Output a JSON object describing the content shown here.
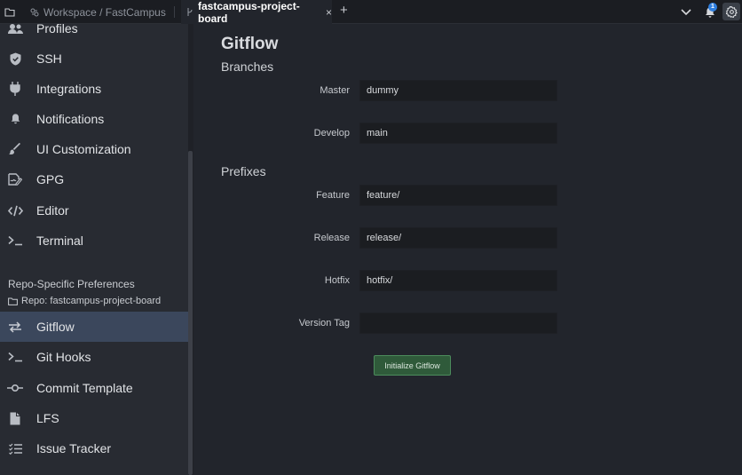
{
  "tabs": {
    "workspace_label": "Workspace / FastCampus",
    "project_label": "fastcampus-project-board",
    "close_glyph": "×",
    "add_glyph": "+"
  },
  "topbar": {
    "notification_count": "1",
    "icons": [
      "folder-icon",
      "chevron-down-icon",
      "bell-icon",
      "gear-icon"
    ]
  },
  "sidebar": {
    "global_items": [
      {
        "label": "Profiles",
        "icon": "users-icon"
      },
      {
        "label": "SSH",
        "icon": "shield-icon"
      },
      {
        "label": "Integrations",
        "icon": "plug-icon"
      },
      {
        "label": "Notifications",
        "icon": "bell-icon"
      },
      {
        "label": "UI Customization",
        "icon": "brush-icon"
      },
      {
        "label": "GPG",
        "icon": "signature-icon"
      },
      {
        "label": "Editor",
        "icon": "code-icon"
      },
      {
        "label": "Terminal",
        "icon": "terminal-icon"
      }
    ],
    "repo_section_title": "Repo-Specific Preferences",
    "repo_label": "Repo: fastcampus-project-board",
    "repo_items": [
      {
        "label": "Gitflow",
        "icon": "swap-arrows-icon",
        "active": true
      },
      {
        "label": "Git Hooks",
        "icon": "terminal-icon"
      },
      {
        "label": "Commit Template",
        "icon": "commit-icon"
      },
      {
        "label": "LFS",
        "icon": "file-icon"
      },
      {
        "label": "Issue Tracker",
        "icon": "checklist-icon"
      }
    ]
  },
  "main": {
    "title": "Gitflow",
    "branches_heading": "Branches",
    "prefixes_heading": "Prefixes",
    "fields": {
      "master": {
        "label": "Master",
        "value": "dummy"
      },
      "develop": {
        "label": "Develop",
        "value": "main"
      },
      "feature": {
        "label": "Feature",
        "value": "feature/"
      },
      "release": {
        "label": "Release",
        "value": "release/"
      },
      "hotfix": {
        "label": "Hotfix",
        "value": "hotfix/"
      },
      "version_tag": {
        "label": "Version Tag",
        "value": ""
      }
    },
    "init_button_label": "Initialize Gitflow"
  },
  "colors": {
    "active_item_bg": "#3b475c",
    "init_button_bg": "#2f5a3a",
    "badge_blue": "#2f7fe0"
  }
}
